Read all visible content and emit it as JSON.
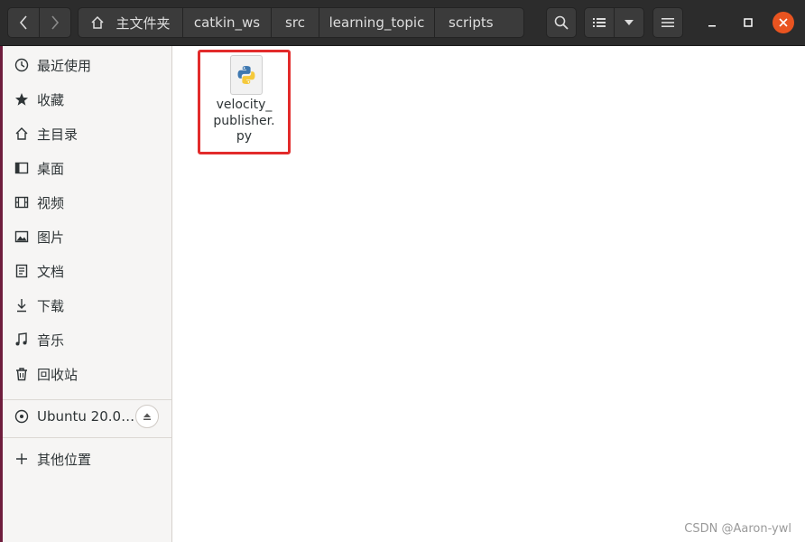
{
  "header": {
    "breadcrumbs": [
      "主文件夹",
      "catkin_ws",
      "src",
      "learning_topic",
      "scripts"
    ]
  },
  "sidebar": {
    "places": [
      {
        "label": "最近使用",
        "icon": "clock-icon"
      },
      {
        "label": "收藏",
        "icon": "star-icon"
      },
      {
        "label": "主目录",
        "icon": "home-icon"
      },
      {
        "label": "桌面",
        "icon": "desktop-icon"
      },
      {
        "label": "视频",
        "icon": "video-icon"
      },
      {
        "label": "图片",
        "icon": "image-icon"
      },
      {
        "label": "文档",
        "icon": "document-icon"
      },
      {
        "label": "下载",
        "icon": "download-icon"
      },
      {
        "label": "音乐",
        "icon": "music-icon"
      },
      {
        "label": "回收站",
        "icon": "trash-icon"
      }
    ],
    "device": {
      "label": "Ubuntu 20.0…",
      "icon": "disc-icon"
    },
    "other": {
      "label": "其他位置",
      "icon": "plus-icon"
    }
  },
  "main": {
    "files": [
      {
        "name": "velocity_\npublisher.\npy",
        "icon": "python-icon"
      }
    ]
  },
  "watermark": "CSDN @Aaron-ywl",
  "colors": {
    "accent": "#e95420",
    "highlight": "#e22b2b",
    "header": "#2c2c2c"
  }
}
